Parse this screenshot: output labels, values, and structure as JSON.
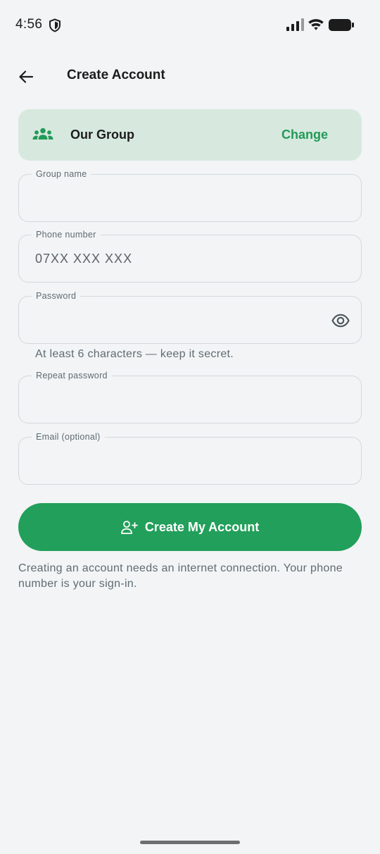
{
  "status_bar": {
    "time": "4:56",
    "icons": [
      "shield-icon",
      "signal-icon",
      "wifi-icon",
      "battery-icon"
    ]
  },
  "app_bar": {
    "back_icon": "arrow-left-icon",
    "title": "Create Account"
  },
  "group_card": {
    "icon": "group-icon",
    "name": "Our Group",
    "change_label": "Change"
  },
  "form": {
    "group_name": {
      "label": "Group name",
      "value": "",
      "placeholder": ""
    },
    "phone_number": {
      "label": "Phone number",
      "value": "",
      "placeholder": "07XX XXX XXX"
    },
    "password": {
      "label": "Password",
      "value": "",
      "placeholder": "",
      "toggle_icon": "eye-icon"
    },
    "password_helper": "At least 6 characters — keep it secret.",
    "repeat_password": {
      "label": "Repeat password",
      "value": "",
      "placeholder": ""
    },
    "email": {
      "label": "Email (optional)",
      "value": "",
      "placeholder": ""
    }
  },
  "create_button": {
    "icon": "person-add-icon",
    "label": "Create My Account"
  },
  "note": "Creating an account needs an internet connection. Your phone number is your sign-in.",
  "colors": {
    "accent": "#229f5a",
    "card_background": "#d7e9df",
    "page_background": "#f2f4f5"
  }
}
